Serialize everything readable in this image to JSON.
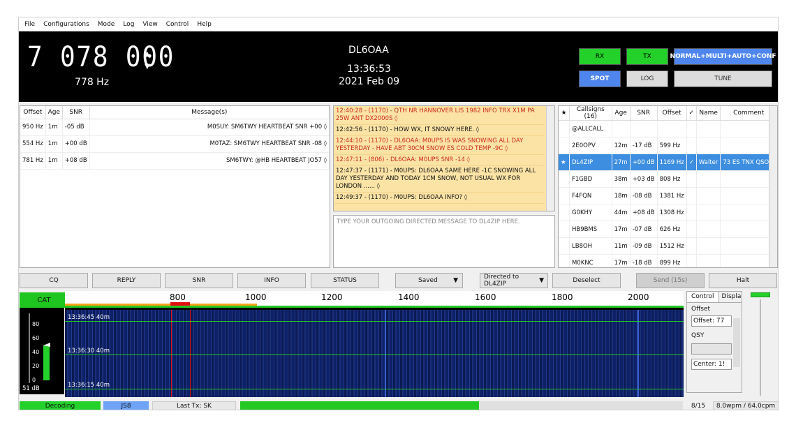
{
  "menu": [
    "File",
    "Configurations",
    "Mode",
    "Log",
    "View",
    "Control",
    "Help"
  ],
  "header": {
    "frequency": "7 078 000",
    "offset_hz": "778 Hz",
    "callsign": "DL6OAA",
    "time": "13:36:53",
    "date": "2021 Feb 09",
    "buttons": {
      "rx": "RX",
      "tx": "TX",
      "mode": "NORMAL+MULTI+AUTO+CONF",
      "spot": "SPOT",
      "log": "LOG",
      "tune": "TUNE"
    }
  },
  "activity": {
    "columns": [
      "Offset",
      "Age",
      "SNR",
      "Message(s)"
    ],
    "rows": [
      {
        "offset": "950 Hz",
        "age": "1m",
        "snr": "-05 dB",
        "message": "M0SUY: SM6TWY HEARTBEAT SNR +00 ◊"
      },
      {
        "offset": "554 Hz",
        "age": "1m",
        "snr": "+00 dB",
        "message": "M0TAZ: SM6TWY HEARTBEAT SNR -08 ◊"
      },
      {
        "offset": "781 Hz",
        "age": "1m",
        "snr": "+08 dB",
        "message": "SM6TWY: @HB HEARTBEAT JO57 ◊"
      }
    ]
  },
  "chat": [
    {
      "text": "12:40:28 - (1170) - QTH NR HANNOVER LIS 1982 INFO TRX X1M PA 25W ANT DX2000S ◊",
      "red": true
    },
    {
      "text": "12:42:56 - (1170) - HOW WX, IT SNOWY HERE. ◊",
      "red": false
    },
    {
      "text": "12:44:10 - (1170) - DL6OAA: M0UPS  IS WAS SNOWING ALL DAY YESTERDAY - HAVE ABT 30CM SNOW ES COLD TEMP -9C ◊",
      "red": true
    },
    {
      "text": "12:47:11 - (806) - DL6OAA: M0UPS SNR -14 ◊",
      "red": true
    },
    {
      "text": "12:47:37 - (1171) - M0UPS: DL6OAA  SAME HERE -1C SNOWING ALL DAY YESTERDAY AND TODAY 1CM SNOW, NOT USUAL WX FOR LONDON ...... ◊",
      "red": false
    },
    {
      "text": "12:49:37 - (1170) - M0UPS: DL6OAA INFO? ◊",
      "red": false
    }
  ],
  "compose": {
    "placeholder": "TYPE YOUR OUTGOING DIRECTED MESSAGE TO DL4ZIP HERE."
  },
  "callsigns": {
    "columns": [
      "★",
      "Callsigns (16)",
      "Age",
      "SNR",
      "Offset",
      "✓",
      "Name",
      "Comment"
    ],
    "rows": [
      {
        "star": "",
        "call": "@ALLCALL",
        "age": "",
        "snr": "",
        "offset": "",
        "check": "",
        "name": "",
        "comment": "",
        "selected": false
      },
      {
        "star": "",
        "call": "2E0OPV",
        "age": "12m",
        "snr": "-17 dB",
        "offset": "599 Hz",
        "check": "",
        "name": "",
        "comment": "",
        "selected": false
      },
      {
        "star": "★",
        "call": "DL4ZIP",
        "age": "27m",
        "snr": "+00 dB",
        "offset": "1169 Hz",
        "check": "✓",
        "name": "Walter",
        "comment": "73 ES TNX QSO...",
        "selected": true
      },
      {
        "star": "",
        "call": "F1GBD",
        "age": "38m",
        "snr": "+03 dB",
        "offset": "808 Hz",
        "check": "",
        "name": "",
        "comment": "",
        "selected": false
      },
      {
        "star": "",
        "call": "F4FQN",
        "age": "18m",
        "snr": "-08 dB",
        "offset": "1381 Hz",
        "check": "",
        "name": "",
        "comment": "",
        "selected": false
      },
      {
        "star": "",
        "call": "G0KHY",
        "age": "44m",
        "snr": "+08 dB",
        "offset": "1308 Hz",
        "check": "",
        "name": "",
        "comment": "",
        "selected": false
      },
      {
        "star": "",
        "call": "HB9BMS",
        "age": "17m",
        "snr": "-07 dB",
        "offset": "626 Hz",
        "check": "",
        "name": "",
        "comment": "",
        "selected": false
      },
      {
        "star": "",
        "call": "LB8OH",
        "age": "11m",
        "snr": "-09 dB",
        "offset": "1512 Hz",
        "check": "",
        "name": "",
        "comment": "",
        "selected": false
      },
      {
        "star": "",
        "call": "M0KNC",
        "age": "17m",
        "snr": "-18 dB",
        "offset": "899 Hz",
        "check": "",
        "name": "",
        "comment": "",
        "selected": false
      }
    ]
  },
  "actions": {
    "cq": "CQ",
    "reply": "REPLY",
    "snr": "SNR",
    "info": "INFO",
    "status": "STATUS",
    "saved": "Saved",
    "directed": "Directed to DL4ZIP",
    "deselect": "Deselect",
    "send": "Send (15s)",
    "halt": "Halt"
  },
  "waterfall": {
    "cat": "CAT",
    "ticks": [
      "800",
      "1000",
      "1200",
      "1400",
      "1600",
      "1800",
      "2000"
    ],
    "stamps": [
      "13:36:45   40m",
      "13:36:30   40m",
      "13:36:15   40m"
    ],
    "meter_labels": [
      "80",
      "60",
      "40",
      "20",
      "0"
    ],
    "meter_db": "51 dB",
    "signal_level_db": 51
  },
  "side": {
    "tab_control": "Control",
    "tab_display": "Displa",
    "offset_label": "Offset",
    "offset_value": "Offset: 77",
    "qsy_label": "QSY",
    "center_value": "Center: 1!"
  },
  "status": {
    "decoding": "Decoding",
    "js8": "JS8",
    "last_tx": "Last Tx: SK",
    "period": "8/15",
    "wpm": "8.0wpm / 64.0cpm"
  },
  "colors": {
    "green": "#23d12a",
    "blue": "#4f86ee",
    "chat_bg": "#fbe3a6",
    "chat_red": "#cc2a1a",
    "selected_row": "#3d8ee0"
  }
}
